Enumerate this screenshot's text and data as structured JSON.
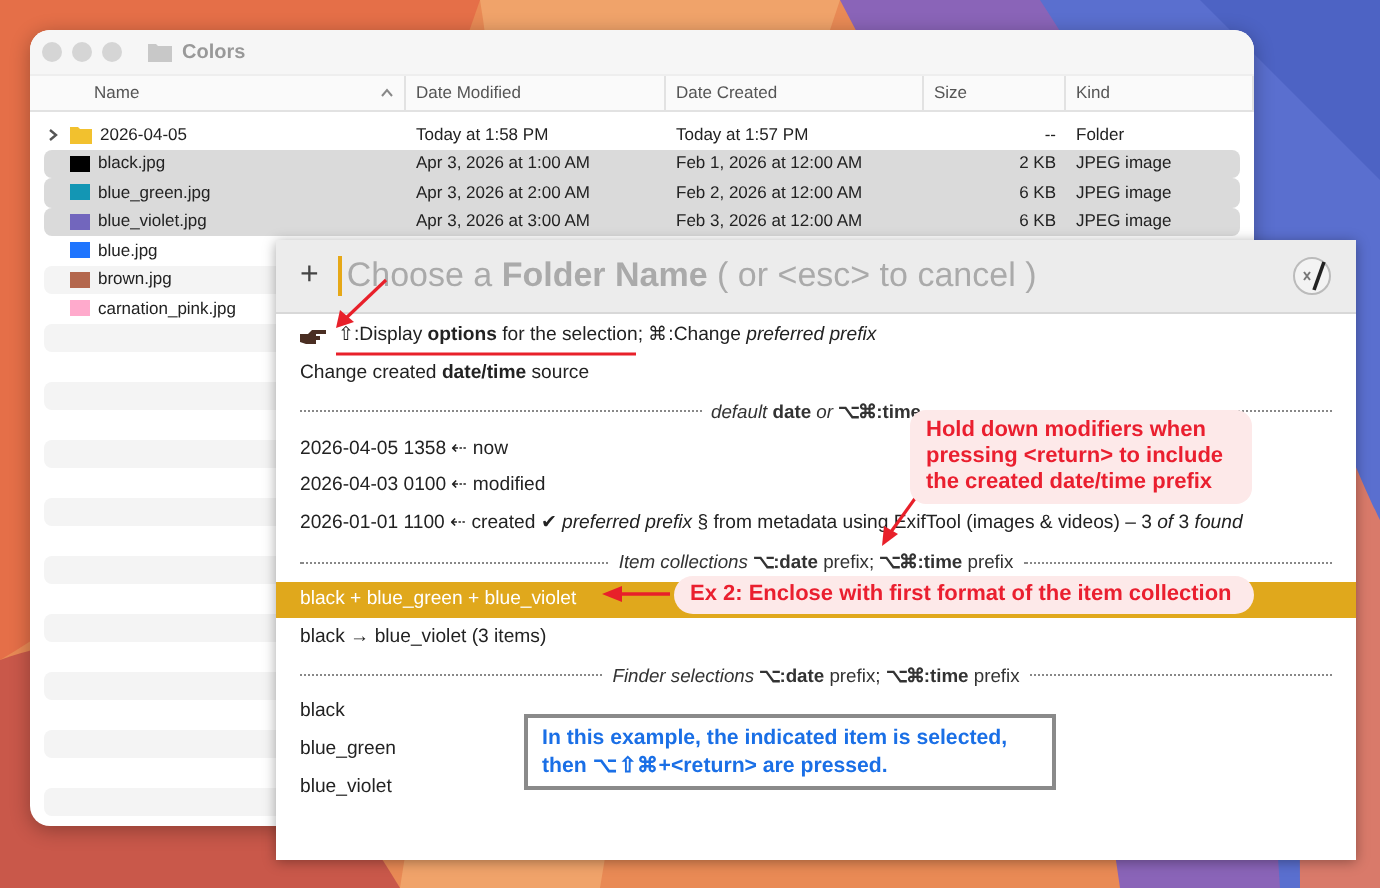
{
  "finder": {
    "title": "Colors",
    "columns": [
      {
        "label": "Name",
        "sorted": true
      },
      {
        "label": "Date Modified",
        "sorted": false
      },
      {
        "label": "Date Created",
        "sorted": false
      },
      {
        "label": "Size",
        "sorted": false
      },
      {
        "label": "Kind",
        "sorted": false
      }
    ],
    "rows": [
      {
        "kind": "folder",
        "name": "2026-04-05",
        "date_modified": "Today at 1:58 PM",
        "date_created": "Today at 1:57 PM",
        "size": "--",
        "file_kind": "Folder",
        "selected": false
      },
      {
        "kind": "file",
        "color": "#000000",
        "name": "black.jpg",
        "date_modified": "Apr 3, 2026 at 1:00 AM",
        "date_created": "Feb 1, 2026 at 12:00 AM",
        "size": "2 KB",
        "file_kind": "JPEG image",
        "selected": true
      },
      {
        "kind": "file",
        "color": "#1396b4",
        "name": "blue_green.jpg",
        "date_modified": "Apr 3, 2026 at 2:00 AM",
        "date_created": "Feb 2, 2026 at 12:00 AM",
        "size": "6 KB",
        "file_kind": "JPEG image",
        "selected": true
      },
      {
        "kind": "file",
        "color": "#7266bd",
        "name": "blue_violet.jpg",
        "date_modified": "Apr 3, 2026 at 3:00 AM",
        "date_created": "Feb 3, 2026 at 12:00 AM",
        "size": "6 KB",
        "file_kind": "JPEG image",
        "selected": true
      },
      {
        "kind": "file",
        "color": "#1f75fe",
        "name": "blue.jpg",
        "selected": false
      },
      {
        "kind": "file",
        "color": "#b4674d",
        "name": "brown.jpg",
        "selected": false
      },
      {
        "kind": "file",
        "color": "#ffaacc",
        "name": "carnation_pink.jpg",
        "selected": false
      }
    ]
  },
  "prompt": {
    "add": "+",
    "placeholder": "Choose a **Folder Name** ( or <esc> to cancel )",
    "items": [
      {
        "kind": "hint",
        "text": "⇧:Display **options** for the selection; ⌘:Change *preferred prefix*"
      },
      {
        "kind": "item",
        "text": "Change created **date/time** source",
        "selected": false
      },
      {
        "kind": "separator",
        "text": "*default* **date** *or* **⌥⌘:time**"
      },
      {
        "kind": "item",
        "text": "2026-04-05 1358 ⇠ now",
        "selected": false
      },
      {
        "kind": "item",
        "text": "2026-04-03 0100 ⇠ modified",
        "selected": false
      },
      {
        "kind": "item",
        "text": "2026-01-01 1100 ⇠ created  ✔ *preferred prefix*  § from metadata using ExifTool (images & videos) – 3 *of* 3 *found*",
        "selected": false
      },
      {
        "kind": "separator",
        "text": "*Item collections*  **⌥:date** prefix; **⌥⌘:time** prefix"
      },
      {
        "kind": "item",
        "text": "black + blue_green + blue_violet",
        "selected": true
      },
      {
        "kind": "item",
        "text": "black → blue_violet (3 items)",
        "selected": false
      },
      {
        "kind": "separator",
        "text": "*Finder selections*  **⌥:date** prefix; **⌥⌘:time** prefix"
      },
      {
        "kind": "item",
        "text": "black",
        "selected": false
      },
      {
        "kind": "item",
        "text": "blue_green",
        "selected": false
      },
      {
        "kind": "item",
        "text": "blue_violet",
        "selected": false
      }
    ]
  },
  "annotations": [
    {
      "kind": "callout",
      "text": "Hold down modifiers when pressing <return> to include the created date/time prefix"
    },
    {
      "kind": "pill",
      "text": "Ex 2: Enclose with first format of the item collection"
    },
    {
      "kind": "note",
      "text": "In this example, the indicated item is selected, then ⌥⇧⌘+<return> are pressed."
    }
  ]
}
